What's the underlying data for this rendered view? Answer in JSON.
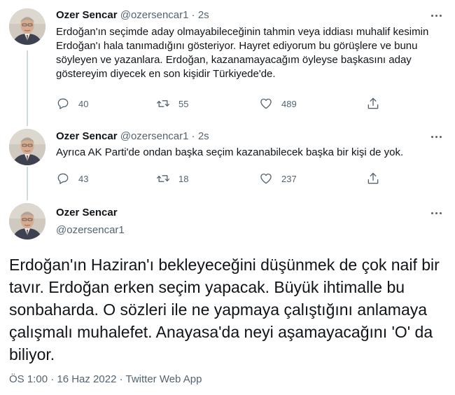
{
  "tweets": [
    {
      "name": "Ozer Sencar",
      "handle": "@ozersencar1",
      "separator": "·",
      "time": "2s",
      "text": "Erdoğan'ın seçimde aday olmayabileceğinin tahmin veya iddiası muhalif kesimin Erdoğan'ı hala tanımadığını gösteriyor. Hayret ediyorum bu görüşlere ve bunu söyleyen ve yazanlara. Erdoğan, kazanamayacağım öyleyse başkasını aday göstereyim diyecek en son kişidir Türkiyede'de.",
      "replies": "40",
      "retweets": "55",
      "likes": "489"
    },
    {
      "name": "Ozer Sencar",
      "handle": "@ozersencar1",
      "separator": "·",
      "time": "2s",
      "text": "Ayrıca AK Parti'de ondan başka seçim kazanabilecek başka bir kişi de yok.",
      "replies": "43",
      "retweets": "18",
      "likes": "237"
    }
  ],
  "main_tweet": {
    "name": "Ozer Sencar",
    "handle": "@ozersencar1",
    "text": "Erdoğan'ın Haziran'ı bekleyeceğini düşünmek de çok naif bir tavır. Erdoğan erken seçim yapacak. Büyük ihtimalle bu sonbaharda. O sözleri ile ne yapmaya çalıştığını anlamaya çalışmalı muhalefet. Anayasa'da neyi aşamayacağını 'O' da biliyor.",
    "timestamp": "ÖS 1:00 · 16 Haz 2022 · Twitter Web App"
  },
  "icons": {
    "reply": "reply-icon",
    "retweet": "retweet-icon",
    "like": "heart-icon",
    "share": "share-icon",
    "more": "more-icon"
  },
  "colors": {
    "text": "#0f1419",
    "secondary": "#536471",
    "thread_line": "#cfd9de"
  }
}
